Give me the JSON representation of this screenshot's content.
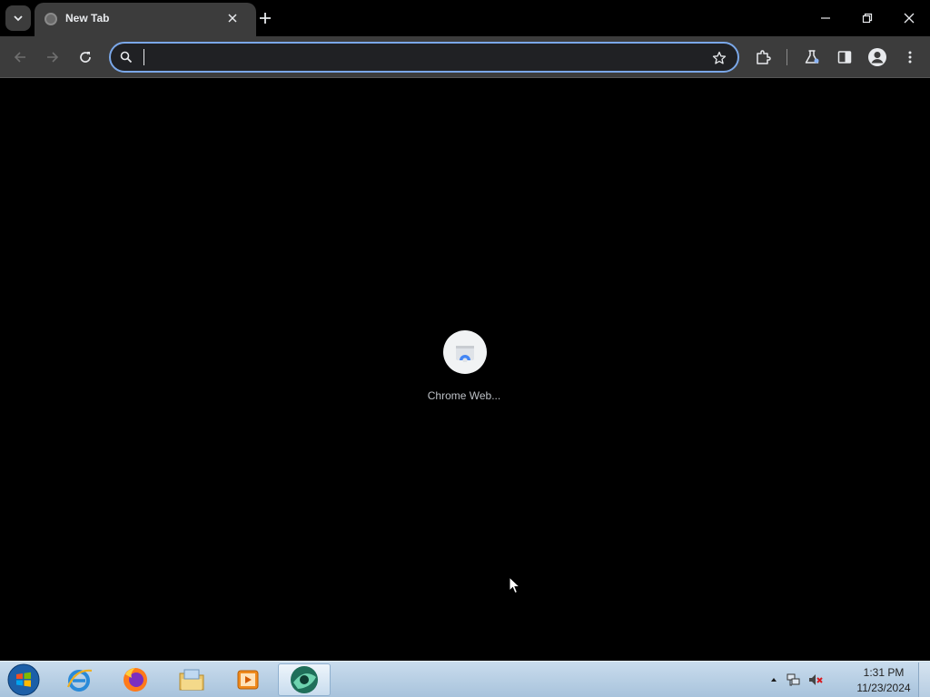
{
  "browser": {
    "tabs": [
      {
        "title": "New Tab"
      }
    ],
    "omnibox": {
      "value": "",
      "placeholder": ""
    },
    "colors": {
      "tabstrip": "#000000",
      "toolbar": "#3c3c3c",
      "omnibox_focus_ring": "#7aa7e8",
      "content_bg": "#000000"
    }
  },
  "new_tab_page": {
    "shortcuts": [
      {
        "label": "Chrome Web...",
        "icon": "chrome-web-store-icon"
      }
    ]
  },
  "taskbar": {
    "apps": [
      {
        "name": "Internet Explorer",
        "icon": "internet-explorer-icon"
      },
      {
        "name": "Firefox",
        "icon": "firefox-icon"
      },
      {
        "name": "File Explorer",
        "icon": "file-explorer-icon"
      },
      {
        "name": "Media Player",
        "icon": "media-player-icon"
      },
      {
        "name": "Chrome Browser",
        "icon": "browser-icon",
        "active": true
      }
    ],
    "clock": {
      "time": "1:31 PM",
      "date": "11/23/2024"
    }
  }
}
